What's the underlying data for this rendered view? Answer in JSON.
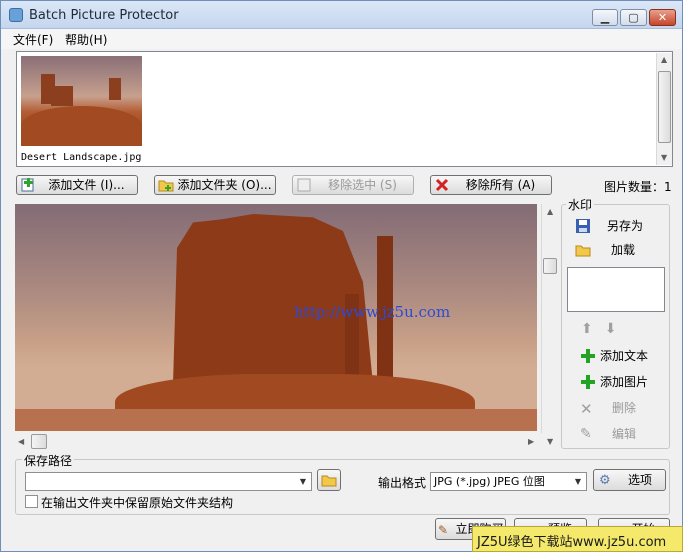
{
  "window": {
    "title": "Batch Picture Protector"
  },
  "menu": [
    "文件(F)",
    "帮助(H)"
  ],
  "thumbnail": {
    "filename": "Desert Landscape.jpg"
  },
  "toolbar": {
    "add_file": "添加文件 (I)...",
    "add_folder": "添加文件夹 (O)...",
    "remove_selected": "移除选中 (S)",
    "remove_all": "移除所有 (A)",
    "count_label": "图片数量：",
    "count_value": "1"
  },
  "preview": {
    "watermark_text": "http://www.jz5u.com"
  },
  "watermark_panel": {
    "title": "水印",
    "save_as": "另存为",
    "load": "加载",
    "add_text": "添加文本",
    "add_image": "添加图片",
    "delete": "删除",
    "edit": "编辑"
  },
  "save": {
    "group_title": "保存路径",
    "path_value": "",
    "keep_structure": "在输出文件夹中保留原始文件夹结构",
    "format_label": "输出格式",
    "format_value": "JPG (*.jpg) JPEG 位图",
    "options": "选项"
  },
  "bottom": {
    "buy_now": "立即购买",
    "preview": "预览",
    "start": "开始"
  },
  "site_banner": "JZ5U绿色下载站www.jz5u.com"
}
